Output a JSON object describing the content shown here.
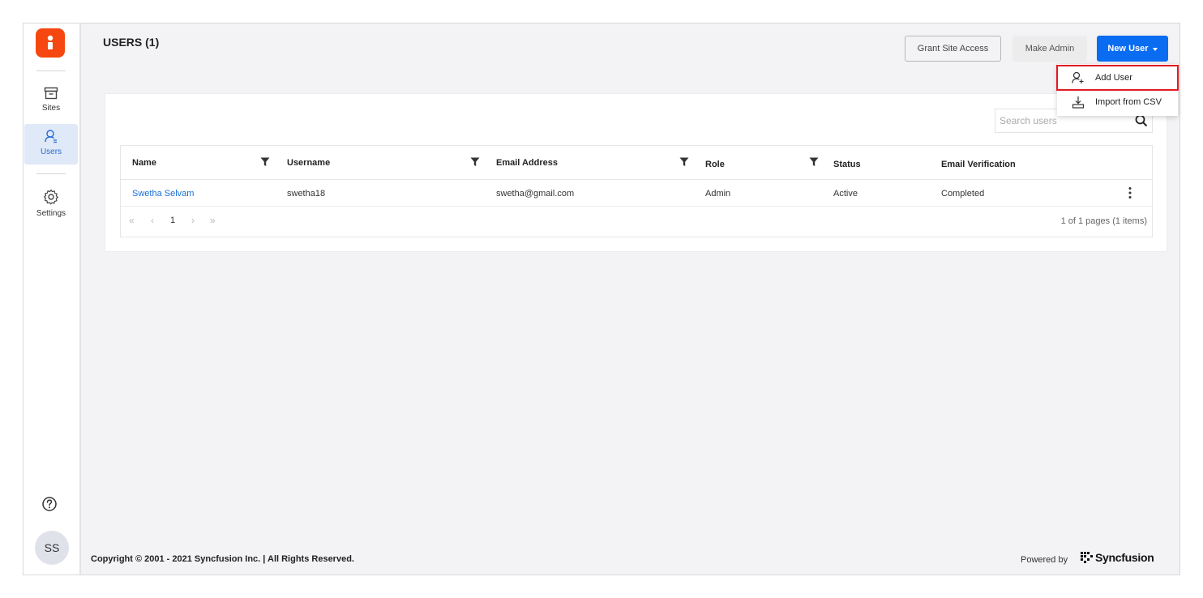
{
  "sidebar": {
    "items": [
      {
        "label": "Sites",
        "icon": "sites-icon"
      },
      {
        "label": "Users",
        "icon": "users-icon",
        "active": true
      },
      {
        "label": "Settings",
        "icon": "gear-icon"
      }
    ],
    "avatar_initials": "SS"
  },
  "header": {
    "title": "USERS (1)",
    "grant_label": "Grant Site Access",
    "admin_label": "Make Admin",
    "new_user_label": "New User"
  },
  "menu": {
    "add_user": "Add User",
    "import_csv": "Import from CSV"
  },
  "search": {
    "placeholder": "Search users"
  },
  "table": {
    "columns": [
      "Name",
      "Username",
      "Email Address",
      "Role",
      "Status",
      "Email Verification"
    ],
    "rows": [
      {
        "name": "Swetha Selvam",
        "username": "swetha18",
        "email": "swetha@gmail.com",
        "role": "Admin",
        "status": "Active",
        "verification": "Completed"
      }
    ]
  },
  "pager": {
    "first": "«",
    "prev": "‹",
    "page": "1",
    "next": "›",
    "last": "»",
    "info": "1 of 1 pages (1 items)"
  },
  "footer": {
    "copyright": "Copyright © 2001 - 2021 Syncfusion Inc. | All Rights Reserved.",
    "powered_by": "Powered by",
    "brand": "Syncfusion"
  },
  "colors": {
    "accent": "#0a6cf0",
    "logo": "#f5470f",
    "highlight_box": "#e31b23",
    "link": "#1a6fd6"
  }
}
